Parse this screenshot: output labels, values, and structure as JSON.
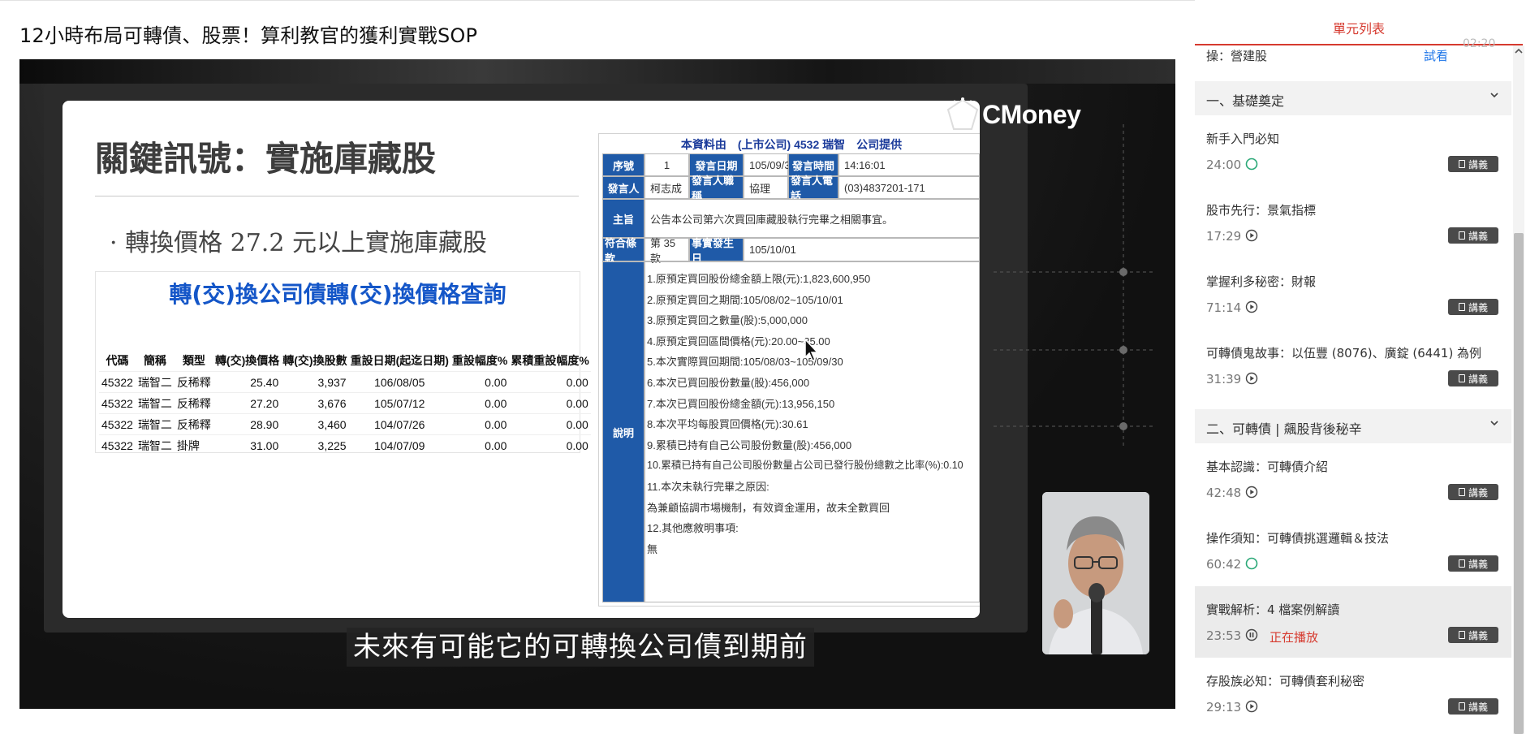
{
  "course": {
    "title": "12小時布局可轉債、股票！算利教官的獲利實戰SOP"
  },
  "slide": {
    "heading": "關鍵訊號：實施庫藏股",
    "bullet": "·  轉換價格 27.2 元以上實施庫藏股",
    "conversion": {
      "title": "轉(交)換公司債轉(交)換價格查詢",
      "headers": [
        "代碼",
        "簡稱",
        "類型",
        "轉(交)換價格",
        "轉(交)換股數",
        "重設日期(起迄日期)",
        "重設幅度%",
        "累積重設幅度%"
      ],
      "rows": [
        [
          "45322",
          "瑞智二",
          "反稀釋",
          "25.40",
          "3,937",
          "106/08/05",
          "0.00",
          "0.00"
        ],
        [
          "45322",
          "瑞智二",
          "反稀釋",
          "27.20",
          "3,676",
          "105/07/12",
          "0.00",
          "0.00"
        ],
        [
          "45322",
          "瑞智二",
          "反稀釋",
          "28.90",
          "3,460",
          "104/07/26",
          "0.00",
          "0.00"
        ],
        [
          "45322",
          "瑞智二",
          "掛牌",
          "31.00",
          "3,225",
          "104/07/09",
          "0.00",
          "0.00"
        ]
      ]
    },
    "announcement": {
      "header": "本資料由　(上市公司) 4532 瑞智　公司提供",
      "seq_label": "序號",
      "seq_value": "1",
      "date_label": "發言日期",
      "date_value": "105/09/30",
      "time_label": "發言時間",
      "time_value": "14:16:01",
      "speaker_label": "發言人",
      "speaker_value": "柯志成",
      "title_label": "發言人職稱",
      "title_value": "協理",
      "phone_label": "發言人電話",
      "phone_value": "(03)4837201-171",
      "subject_label": "主旨",
      "subject_value": "公告本公司第六次買回庫藏股執行完畢之相關事宜。",
      "clause_label": "符合條款",
      "clause_value": "第 35 款",
      "event_label": "事實發生日",
      "event_value": "105/10/01",
      "desc_label": "說明",
      "lines": [
        "1.原預定買回股份總金額上限(元):1,823,600,950",
        "2.原預定買回之期間:105/08/02~105/10/01",
        "3.原預定買回之數量(股):5,000,000",
        "4.原預定買回區間價格(元):20.00~35.00",
        "5.本次實際買回期間:105/08/03~105/09/30",
        "6.本次已買回股份數量(股):456,000",
        "7.本次已買回股份總金額(元):13,956,150",
        "8.本次平均每股買回價格(元):30.61",
        "9.累積已持有自己公司股份數量(股):456,000",
        "10.累積已持有自己公司股份數量占公司已發行股份總數之比率(%):0.10",
        "11.本次未執行完畢之原因:",
        "為兼顧協調市場機制，有效資金運用，故未全數買回",
        "12.其他應敘明事項:",
        "無"
      ]
    }
  },
  "logo": {
    "text": "CMoney"
  },
  "subtitle": "未來有可能它的可轉換公司債到期前",
  "sidebar": {
    "tab_title": "單元列表",
    "top_item": {
      "title": "操：營建股",
      "try_label": "試看",
      "partial_time": "02:20"
    },
    "sections": [
      {
        "title": "一、基礎奠定",
        "lessons": [
          {
            "title": "新手入門必知",
            "duration": "24:00",
            "status": "circle",
            "notes": "講義"
          },
          {
            "title": "股市先行：景氣指標",
            "duration": "17:29",
            "status": "play",
            "notes": "講義"
          },
          {
            "title": "掌握利多秘密：財報",
            "duration": "71:14",
            "status": "play",
            "notes": "講義"
          },
          {
            "title": "可轉債鬼故事：以伍豐 (8076)、廣錠 (6441) 為例",
            "duration": "31:39",
            "status": "play",
            "notes": "講義"
          }
        ]
      },
      {
        "title": "二、可轉債 | 飆股背後秘辛",
        "lessons": [
          {
            "title": "基本認識：可轉債介紹",
            "duration": "42:48",
            "status": "play",
            "notes": "講義"
          },
          {
            "title": "操作須知：可轉債挑選邏輯＆技法",
            "duration": "60:42",
            "status": "circle",
            "notes": "講義"
          },
          {
            "title": "實戰解析：4 檔案例解讀",
            "duration": "23:53",
            "status": "pause",
            "playing_label": "正在播放",
            "notes": "講義"
          },
          {
            "title": "存股族必知：可轉債套利秘密",
            "duration": "29:13",
            "status": "play",
            "notes": "講義"
          }
        ]
      }
    ]
  }
}
